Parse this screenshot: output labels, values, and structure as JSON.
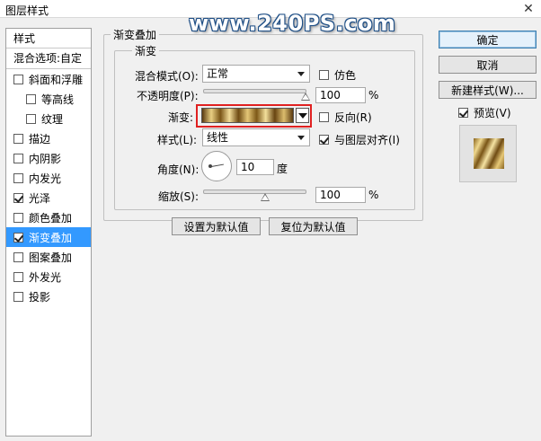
{
  "window": {
    "title": "图层样式"
  },
  "watermark": "www.240PS.com",
  "sidebar": {
    "header": "样式",
    "blend_options": "混合选项:自定",
    "items": [
      {
        "label": "斜面和浮雕",
        "checked": false,
        "indent": false
      },
      {
        "label": "等高线",
        "checked": false,
        "indent": true
      },
      {
        "label": "纹理",
        "checked": false,
        "indent": true
      },
      {
        "label": "描边",
        "checked": false,
        "indent": false
      },
      {
        "label": "内阴影",
        "checked": false,
        "indent": false
      },
      {
        "label": "内发光",
        "checked": false,
        "indent": false
      },
      {
        "label": "光泽",
        "checked": true,
        "indent": false
      },
      {
        "label": "颜色叠加",
        "checked": false,
        "indent": false
      },
      {
        "label": "渐变叠加",
        "checked": true,
        "indent": false,
        "selected": true
      },
      {
        "label": "图案叠加",
        "checked": false,
        "indent": false
      },
      {
        "label": "外发光",
        "checked": false,
        "indent": false
      },
      {
        "label": "投影",
        "checked": false,
        "indent": false
      }
    ]
  },
  "panel": {
    "group_title": "渐变叠加",
    "subgroup_title": "渐变",
    "blend_mode": {
      "label": "混合模式(O):",
      "value": "正常"
    },
    "dither": {
      "label": "仿色",
      "checked": false
    },
    "opacity": {
      "label": "不透明度(P):",
      "value": "100",
      "unit": "%",
      "level": 100
    },
    "gradient": {
      "label": "渐变:"
    },
    "reverse": {
      "label": "反向(R)",
      "checked": false
    },
    "style": {
      "label": "样式(L):",
      "value": "线性"
    },
    "align_with_layer": {
      "label": "与图层对齐(I)",
      "checked": true
    },
    "angle": {
      "label": "角度(N):",
      "value": "10",
      "unit": "度"
    },
    "scale": {
      "label": "缩放(S):",
      "value": "100",
      "unit": "%",
      "level_fraction": 0.5
    },
    "make_default_btn": "设置为默认值",
    "reset_default_btn": "复位为默认值"
  },
  "actions": {
    "ok": "确定",
    "cancel": "取消",
    "new_style": "新建样式(W)...",
    "preview": {
      "label": "预览(V)",
      "checked": true
    }
  },
  "icons": {
    "close": "close-icon",
    "dropdown": "chevron-down-icon",
    "angle_dial": "angle-dial-icon"
  },
  "colors": {
    "selection": "#3399ff",
    "highlight_outline": "#e02020",
    "watermark_stroke": "#1f4f86"
  }
}
